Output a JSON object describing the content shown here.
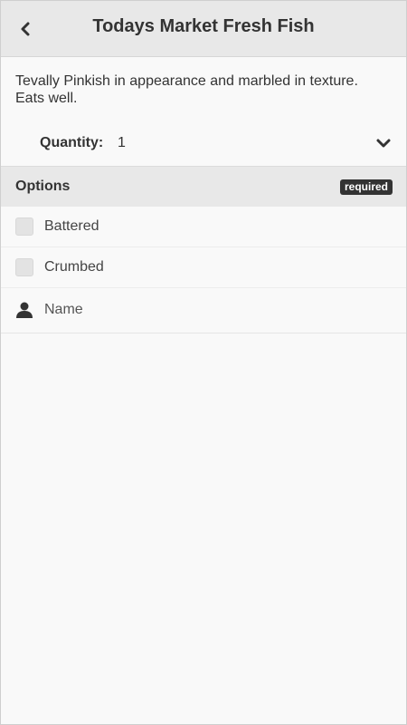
{
  "header": {
    "title": "Todays Market Fresh Fish",
    "back_icon": "chevron-left-icon"
  },
  "product": {
    "description": "Tevally Pinkish in appearance and marbled in texture. Eats well."
  },
  "quantity": {
    "label": "Quantity:",
    "value": "1",
    "icon": "chevron-down-icon"
  },
  "options": {
    "title": "Options",
    "badge": "required",
    "items": [
      {
        "label": "Battered",
        "checked": false
      },
      {
        "label": "Crumbed",
        "checked": false
      }
    ]
  },
  "name_field": {
    "placeholder": "Name",
    "value": "",
    "icon": "user-icon"
  },
  "colors": {
    "header_bg": "#e8e8e8",
    "page_bg": "#f9f9f9",
    "badge_bg": "#333333",
    "text": "#333333"
  }
}
